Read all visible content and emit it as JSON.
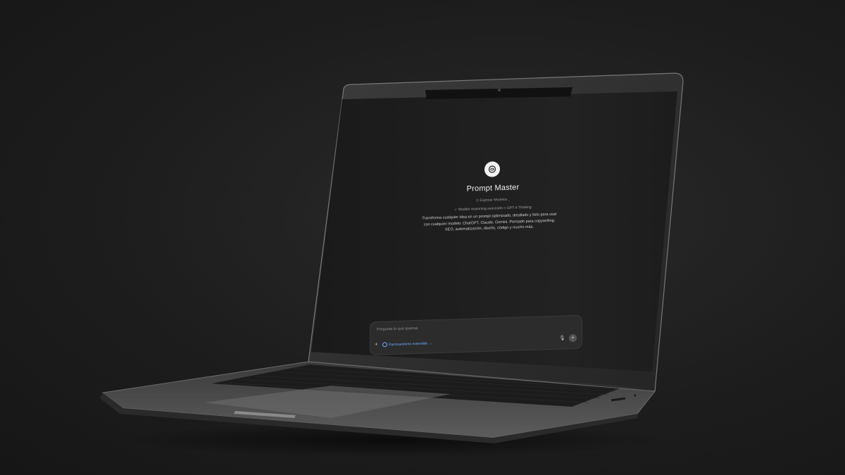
{
  "app": {
    "title": "Prompt Master",
    "model_chip": "⎙ Explorar Modelos ⌄",
    "subtitle": "✓ Modelo reasoning avanzado ∞ GPT-4 Thinking",
    "description": "Transforma cualquier idea en un prompt optimizado, detallado y listo para usar con cualquier modelo: ChatGPT, Claude, Gemini. Pensado para copywriting, SEO, automatización, diseño, código y mucho más.",
    "logo_icon": "spiral-logo-icon"
  },
  "composer": {
    "placeholder": "Pregunta lo que quieras",
    "model_selector_label": "Razonamiento extendido",
    "plus_icon": "plus-icon",
    "mic_icon": "microphone-icon",
    "send_icon": "send-icon"
  },
  "colors": {
    "background": "#1d1d1d",
    "screen": "#1f1f1f",
    "accent": "#6fa8ff",
    "laptop_body": "#5a5a5a"
  }
}
